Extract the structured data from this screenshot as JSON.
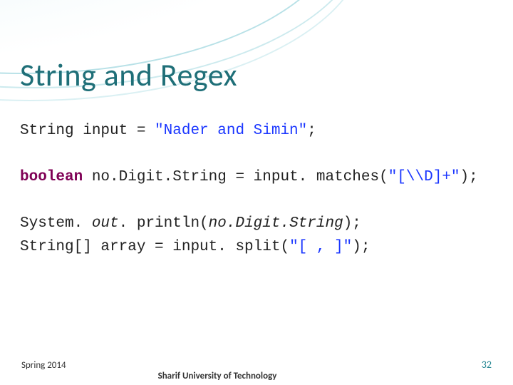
{
  "title": "String and Regex",
  "code": {
    "l1": {
      "a": "String input = ",
      "b": "\"Nader and Simin\"",
      "c": ";"
    },
    "l2": {
      "a": "boolean",
      "b": " no.Digit.String = input. matches(",
      "c": "\"[\\\\D]+\"",
      "d": ");"
    },
    "l3": {
      "a": "System. ",
      "b": "out",
      "c": ". println(",
      "d": "no.Digit.String",
      "e": ");"
    },
    "l4": {
      "a": "String[] array = input. split(",
      "b": "\"[ , ]\"",
      "c": ");"
    }
  },
  "footer": {
    "semester": "Spring 2014",
    "affiliation": "Sharif University of Technology",
    "page": "32"
  }
}
